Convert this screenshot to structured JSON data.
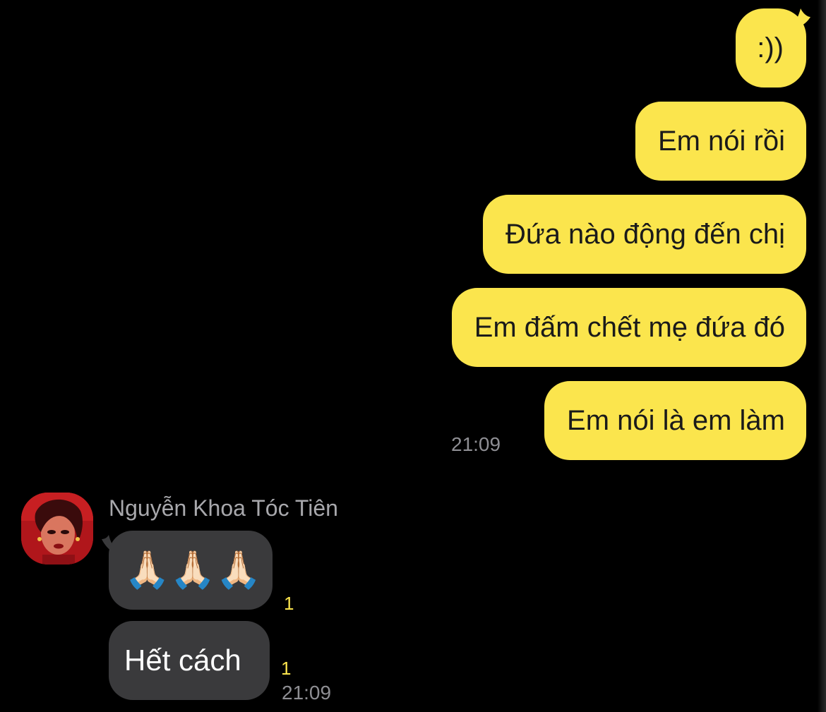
{
  "colors": {
    "background": "#000000",
    "outgoing_bubble": "#FBE54D",
    "incoming_bubble": "#3A3A3C",
    "timestamp": "#8E8E93",
    "unread_badge": "#FBE54D"
  },
  "outgoing": {
    "messages": [
      {
        "text": ":))"
      },
      {
        "text": "Em nói rồi"
      },
      {
        "text": "Đứa nào động đến chị"
      },
      {
        "text": "Em đấm chết mẹ đứa đó"
      },
      {
        "text": "Em nói là em làm"
      }
    ],
    "time": "21:09"
  },
  "incoming": {
    "sender_name": "Nguyễn Khoa Tóc Tiên",
    "avatar_icon": "profile-photo",
    "messages": [
      {
        "text": "🙏🏻🙏🏻🙏🏻",
        "unread": "1",
        "emoji_icon": "folded-hands-icon"
      },
      {
        "text": "Hết cách",
        "unread": "1"
      }
    ],
    "time": "21:09"
  }
}
